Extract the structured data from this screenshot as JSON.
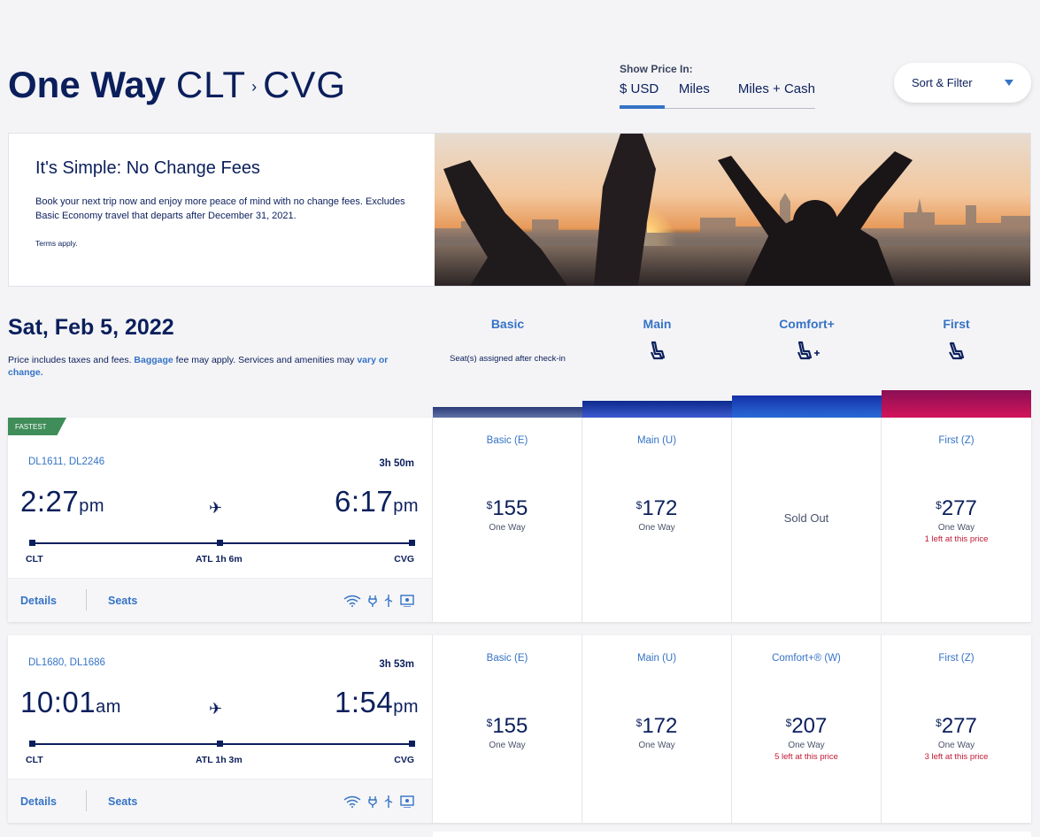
{
  "header": {
    "trip_type": "One Way",
    "origin": "CLT",
    "arrow": "›",
    "destination": "CVG",
    "price_label": "Show Price In:",
    "price_tabs": [
      "$ USD",
      "Miles",
      "Miles + Cash"
    ],
    "sort_filter": "Sort & Filter"
  },
  "banner": {
    "title": "It's Simple: No Change Fees",
    "body": "Book your next trip now and enjoy more peace of mind with no change fees. Excludes Basic Economy travel that departs after December 31, 2021.",
    "terms": "Terms apply."
  },
  "results": {
    "date": "Sat, Feb 5, 2022",
    "disclaimer_pre": "Price includes taxes and fees. ",
    "disclaimer_link1": "Baggage",
    "disclaimer_mid": " fee may apply. Services and amenities may ",
    "disclaimer_link2": "vary or change."
  },
  "columns": [
    {
      "name": "Basic",
      "sub": "Seat(s) assigned after check-in",
      "color": "#3b4d8a"
    },
    {
      "name": "Main",
      "sub": "",
      "color": "#1f3aa6"
    },
    {
      "name": "Comfort+",
      "sub": "",
      "color": "#1f57c3"
    },
    {
      "name": "First",
      "sub": "",
      "color": "#b0124f"
    }
  ],
  "flights": [
    {
      "badge": "FASTEST",
      "flight_numbers": "DL1611, DL2246",
      "duration": "3h 50m",
      "depart_time": "2:27",
      "depart_ampm": "pm",
      "arrive_time": "6:17",
      "arrive_ampm": "pm",
      "origin": "CLT",
      "layover": "ATL 1h 6m",
      "destination": "CVG",
      "details": "Details",
      "seats": "Seats",
      "fares": [
        {
          "class": "Basic (E)",
          "currency": "$",
          "price": "155",
          "note": "One Way",
          "left": ""
        },
        {
          "class": "Main (U)",
          "currency": "$",
          "price": "172",
          "note": "One Way",
          "left": ""
        },
        {
          "class": "",
          "currency": "",
          "price": "",
          "note": "",
          "left": "",
          "soldout": "Sold Out"
        },
        {
          "class": "First (Z)",
          "currency": "$",
          "price": "277",
          "note": "One Way",
          "left": "1 left at this price"
        }
      ]
    },
    {
      "badge": "",
      "flight_numbers": "DL1680, DL1686",
      "duration": "3h 53m",
      "depart_time": "10:01",
      "depart_ampm": "am",
      "arrive_time": "1:54",
      "arrive_ampm": "pm",
      "origin": "CLT",
      "layover": "ATL 1h 3m",
      "destination": "CVG",
      "details": "Details",
      "seats": "Seats",
      "fares": [
        {
          "class": "Basic (E)",
          "currency": "$",
          "price": "155",
          "note": "One Way",
          "left": ""
        },
        {
          "class": "Main (U)",
          "currency": "$",
          "price": "172",
          "note": "One Way",
          "left": ""
        },
        {
          "class": "Comfort+® (W)",
          "currency": "$",
          "price": "207",
          "note": "One Way",
          "left": "5 left at this price"
        },
        {
          "class": "First (Z)",
          "currency": "$",
          "price": "277",
          "note": "One Way",
          "left": "3 left at this price"
        }
      ]
    }
  ]
}
